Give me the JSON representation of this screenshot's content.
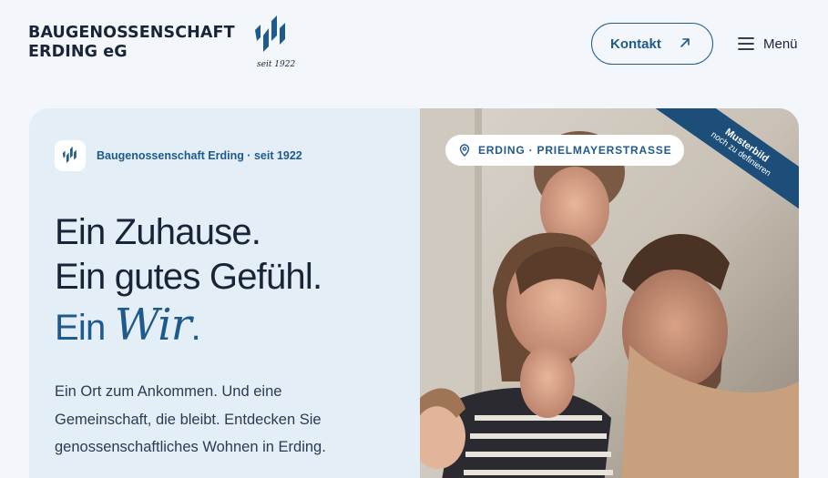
{
  "header": {
    "brand_line1": "BAUGENOSSENSCHAFT",
    "brand_line2": "ERDING eG",
    "logo_since": "seit 1922",
    "contact_label": "Kontakt",
    "menu_label": "Menü"
  },
  "hero": {
    "badge_text": "Baugenossenschaft Erding · seit 1922",
    "headline_line1": "Ein Zuhause.",
    "headline_line2": "Ein gutes Gefühl.",
    "headline_line3_prefix": "Ein",
    "headline_line3_script": "Wir",
    "headline_line3_suffix": ".",
    "intro_text": "Ein Ort zum Ankommen. Und eine Gemeinschaft, die bleibt. Entdecken Sie genossenschaftliches Wohnen in Erding.",
    "location_label": "ERDING · PRIELMAYERSTRASSE",
    "ribbon_line1": "Musterbild",
    "ribbon_line2": "noch zu definieren"
  },
  "colors": {
    "accent": "#1e5a8c",
    "navy": "#1a2438",
    "page_bg": "#f3f6fa",
    "hero_bg": "#e4eef7"
  },
  "icons": {
    "logo": "logo-mark-icon",
    "arrow": "arrow-up-right-icon",
    "menu": "hamburger-icon",
    "location": "map-pin-icon"
  }
}
